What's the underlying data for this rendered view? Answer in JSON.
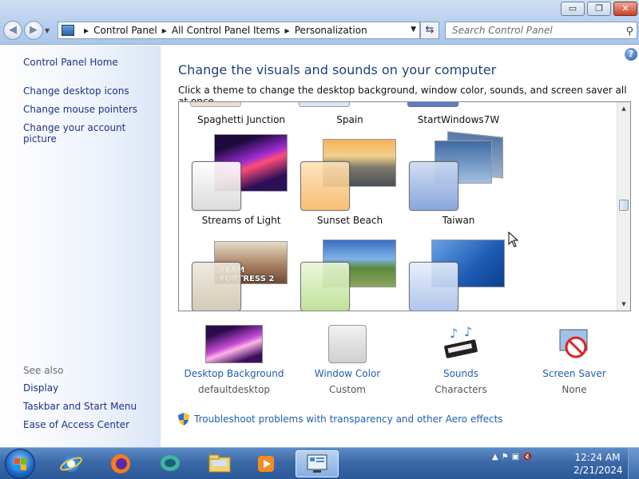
{
  "window": {
    "buttons": {
      "minimize": "▭",
      "maximize": "❐",
      "close": "✕"
    },
    "nav": {
      "back": "◀",
      "forward": "▶"
    },
    "breadcrumb": [
      "Control Panel",
      "All Control Panel Items",
      "Personalization"
    ],
    "search_placeholder": "Search Control Panel"
  },
  "sidebar": {
    "links": [
      "Control Panel Home",
      "Change desktop icons",
      "Change mouse pointers",
      "Change your account picture"
    ],
    "see_also_title": "See also",
    "see_also": [
      "Display",
      "Taskbar and Start Menu",
      "Ease of Access Center"
    ]
  },
  "main": {
    "title": "Change the visuals and sounds on your computer",
    "subtitle": "Click a theme to change the desktop background, window color, sounds, and screen saver all at once.",
    "themes_row1": [
      "Spaghetti Junction",
      "Spain",
      "StartWindows7W"
    ],
    "themes_row2": [
      "Streams of Light",
      "Sunset Beach",
      "Taiwan"
    ],
    "theme_row3_image_text": "TEAM FORTRESS 2",
    "options": [
      {
        "label": "Desktop Background",
        "value": "defaultdesktop"
      },
      {
        "label": "Window Color",
        "value": "Custom"
      },
      {
        "label": "Sounds",
        "value": "Characters"
      },
      {
        "label": "Screen Saver",
        "value": "None"
      }
    ],
    "troubleshoot": "Troubleshoot problems with transparency and other Aero effects"
  },
  "taskbar": {
    "time": "12:24 AM",
    "date": "2/21/2024"
  }
}
